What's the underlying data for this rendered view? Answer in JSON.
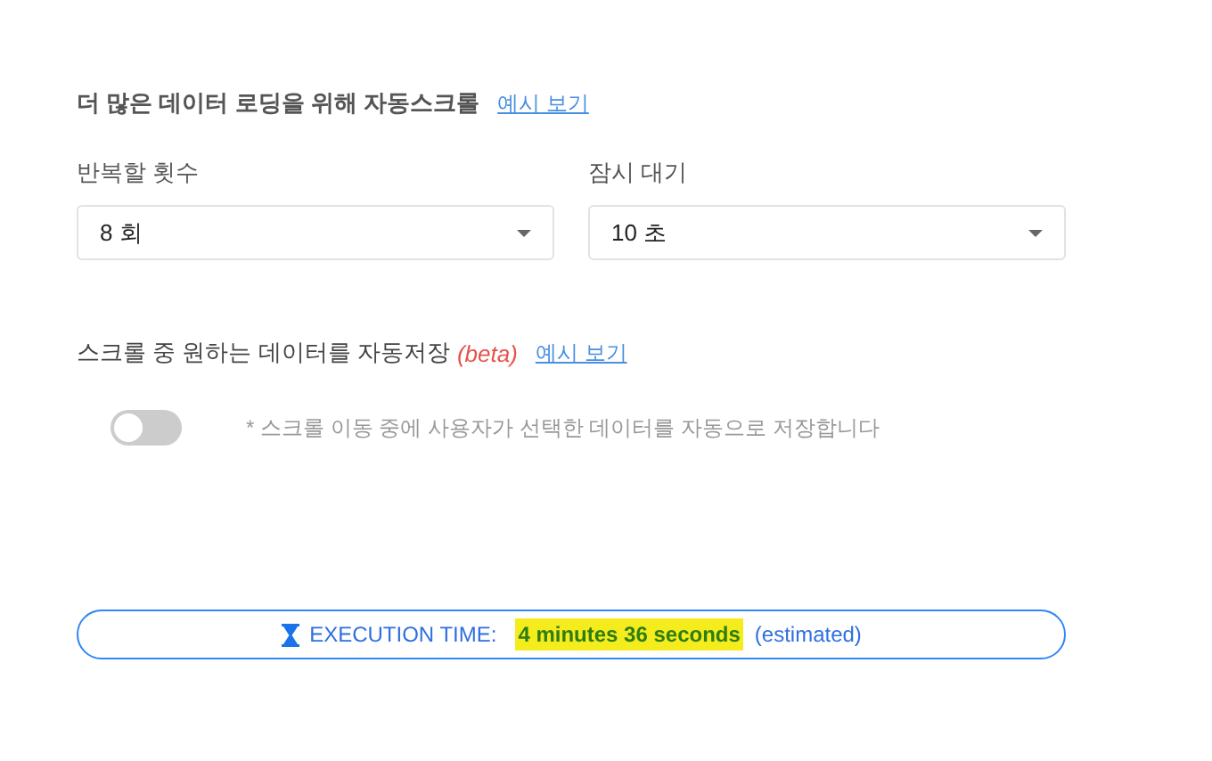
{
  "autoscroll": {
    "title": "더 많은 데이터 로딩을 위해 자동스크롤",
    "example_link": "예시 보기",
    "fields": [
      {
        "label": "반복할 횟수",
        "value": "8 회"
      },
      {
        "label": "잠시 대기",
        "value": "10 초"
      }
    ]
  },
  "autosave": {
    "title": "스크롤 중 원하는 데이터를 자동저장",
    "badge": "(beta)",
    "example_link": "예시 보기",
    "on": false,
    "description": "* 스크롤 이동 중에 사용자가 선택한 데이터를 자동으로 저장합니다"
  },
  "execution": {
    "label": "EXECUTION TIME:",
    "value": "4 minutes 36 seconds",
    "note": "(estimated)"
  }
}
